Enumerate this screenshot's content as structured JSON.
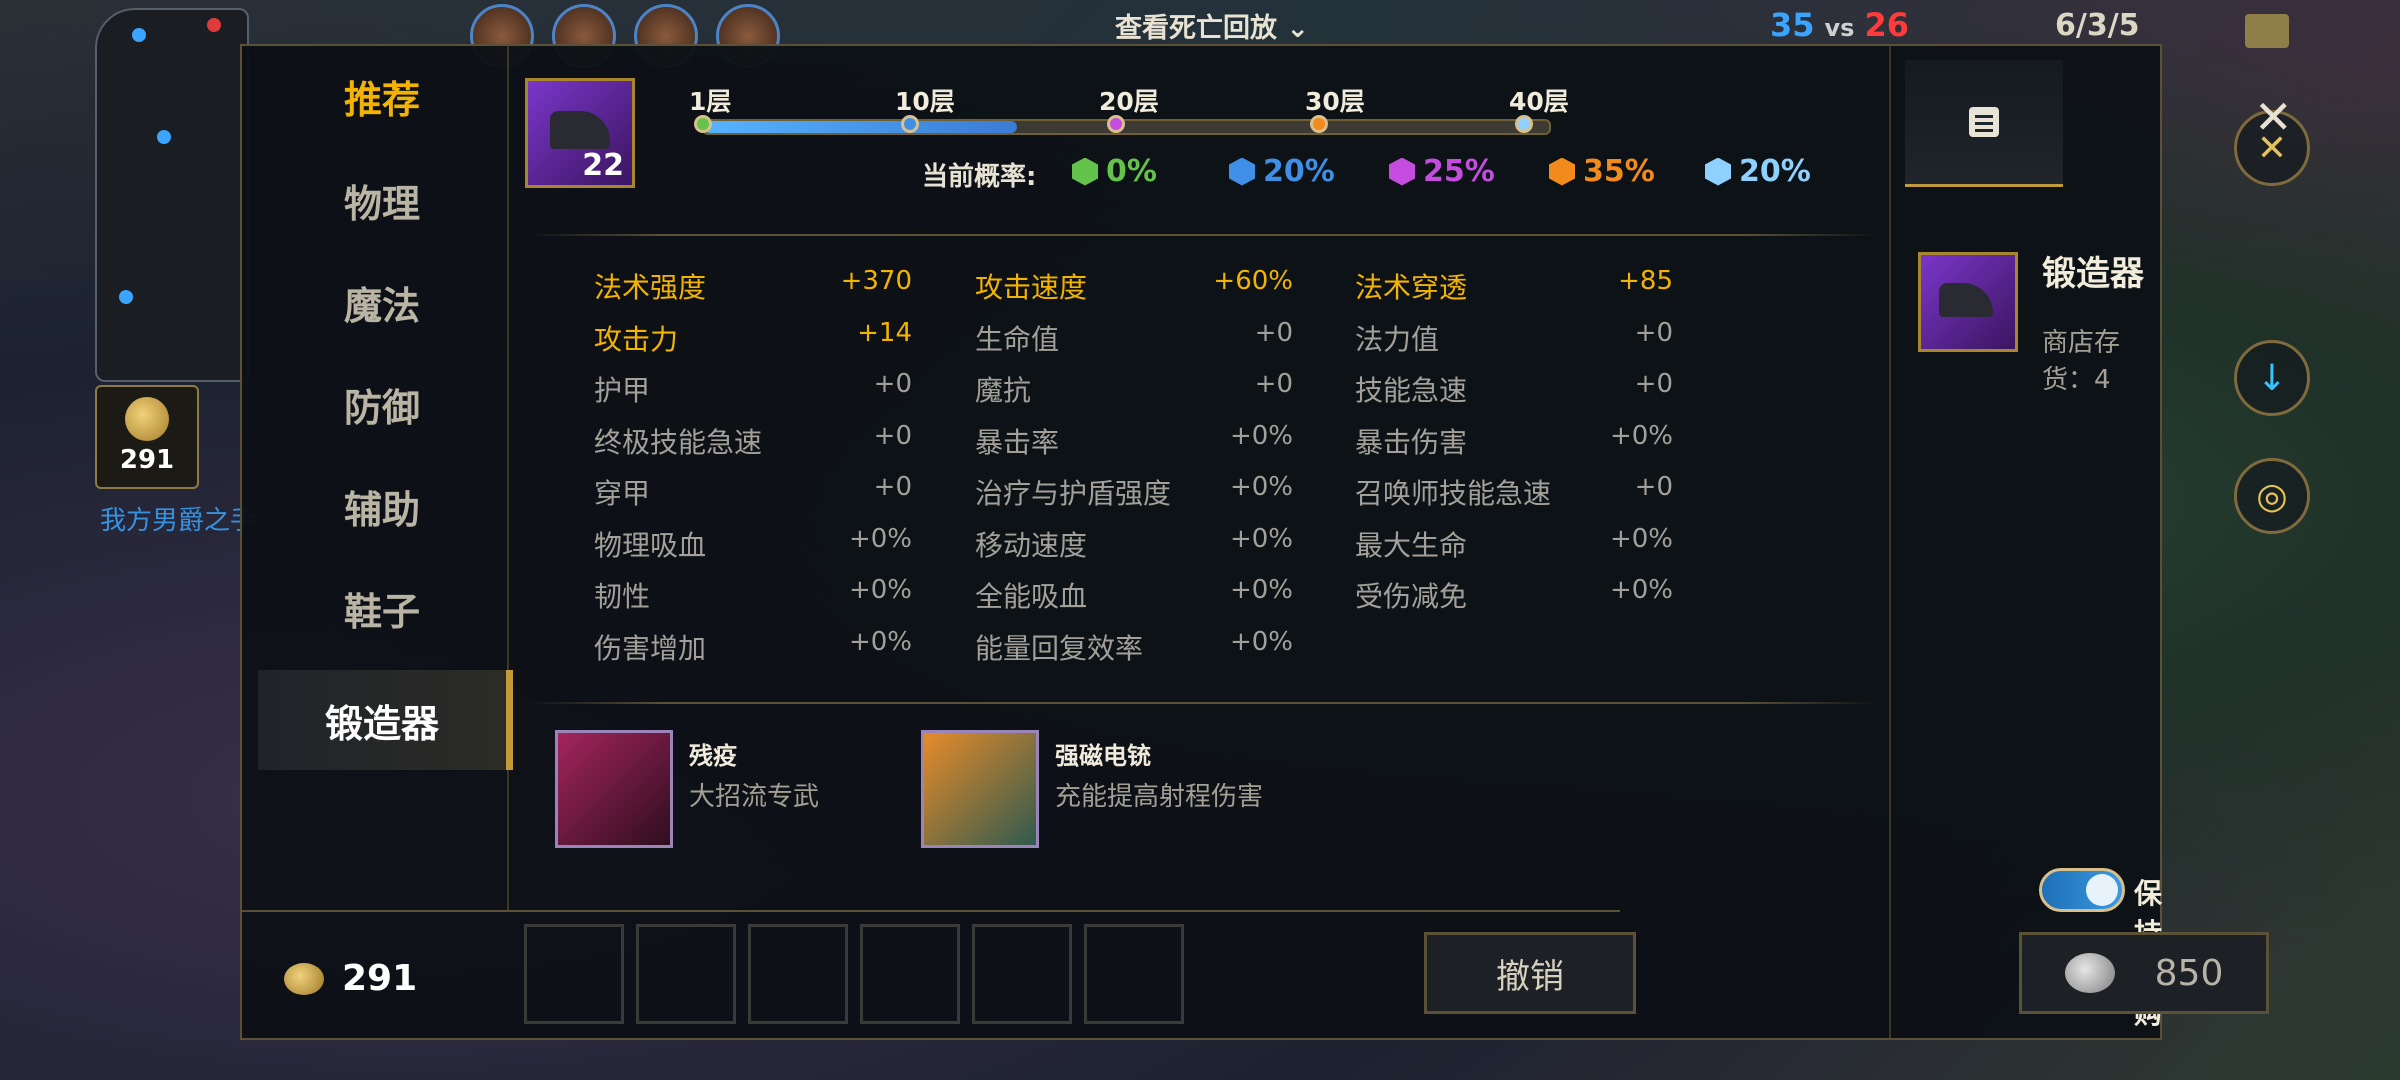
{
  "hud": {
    "death_replay": "查看死亡回放",
    "dropdown_icon": "chevron-down-icon",
    "score_blue": "35",
    "score_vs": "vs",
    "score_red": "26",
    "kda": "6/3/5",
    "gold": "291",
    "chat_message": "我方男爵之手"
  },
  "categories": [
    {
      "label": "推荐"
    },
    {
      "label": "物理"
    },
    {
      "label": "魔法"
    },
    {
      "label": "防御"
    },
    {
      "label": "辅助"
    },
    {
      "label": "鞋子"
    },
    {
      "label": "锻造器"
    }
  ],
  "forge": {
    "stack_count": "22",
    "levels": [
      "1层",
      "10层",
      "20层",
      "30层",
      "40层"
    ],
    "progress_fraction": 0.37,
    "prob_label": "当前概率:",
    "probs": [
      {
        "value": "0%",
        "color": "#63c34a"
      },
      {
        "value": "20%",
        "color": "#3f8fe6"
      },
      {
        "value": "25%",
        "color": "#c44de0"
      },
      {
        "value": "35%",
        "color": "#f28a1c"
      },
      {
        "value": "20%",
        "color": "#8fd0ff"
      }
    ]
  },
  "stats": [
    [
      {
        "name": "法术强度",
        "value": "+370",
        "highlight": true
      },
      {
        "name": "攻击力",
        "value": "+14",
        "highlight": true
      },
      {
        "name": "护甲",
        "value": "+0"
      },
      {
        "name": "终极技能急速",
        "value": "+0"
      },
      {
        "name": "穿甲",
        "value": "+0"
      },
      {
        "name": "物理吸血",
        "value": "+0%"
      },
      {
        "name": "韧性",
        "value": "+0%"
      },
      {
        "name": "伤害增加",
        "value": "+0%"
      }
    ],
    [
      {
        "name": "攻击速度",
        "value": "+60%",
        "highlight": true
      },
      {
        "name": "生命值",
        "value": "+0"
      },
      {
        "name": "魔抗",
        "value": "+0"
      },
      {
        "name": "暴击率",
        "value": "+0%"
      },
      {
        "name": "治疗与护盾强度",
        "value": "+0%"
      },
      {
        "name": "移动速度",
        "value": "+0%"
      },
      {
        "name": "全能吸血",
        "value": "+0%"
      },
      {
        "name": "能量回复效率",
        "value": "+0%"
      }
    ],
    [
      {
        "name": "法术穿透",
        "value": "+85",
        "highlight": true
      },
      {
        "name": "法力值",
        "value": "+0"
      },
      {
        "name": "技能急速",
        "value": "+0"
      },
      {
        "name": "暴击伤害",
        "value": "+0%"
      },
      {
        "name": "召唤师技能急速",
        "value": "+0"
      },
      {
        "name": "最大生命",
        "value": "+0%"
      },
      {
        "name": "受伤减免",
        "value": "+0%"
      }
    ]
  ],
  "recommended": [
    {
      "name": "残疫",
      "desc": "大招流专武"
    },
    {
      "name": "强磁电铳",
      "desc": "充能提高射程伤害"
    }
  ],
  "footer": {
    "gold": "291",
    "undo": "撤销"
  },
  "detail": {
    "item_name": "锻造器",
    "stock": "商店存货：4",
    "keep_preorder": "保持预购",
    "keep_preorder_on": true,
    "price": "850"
  }
}
